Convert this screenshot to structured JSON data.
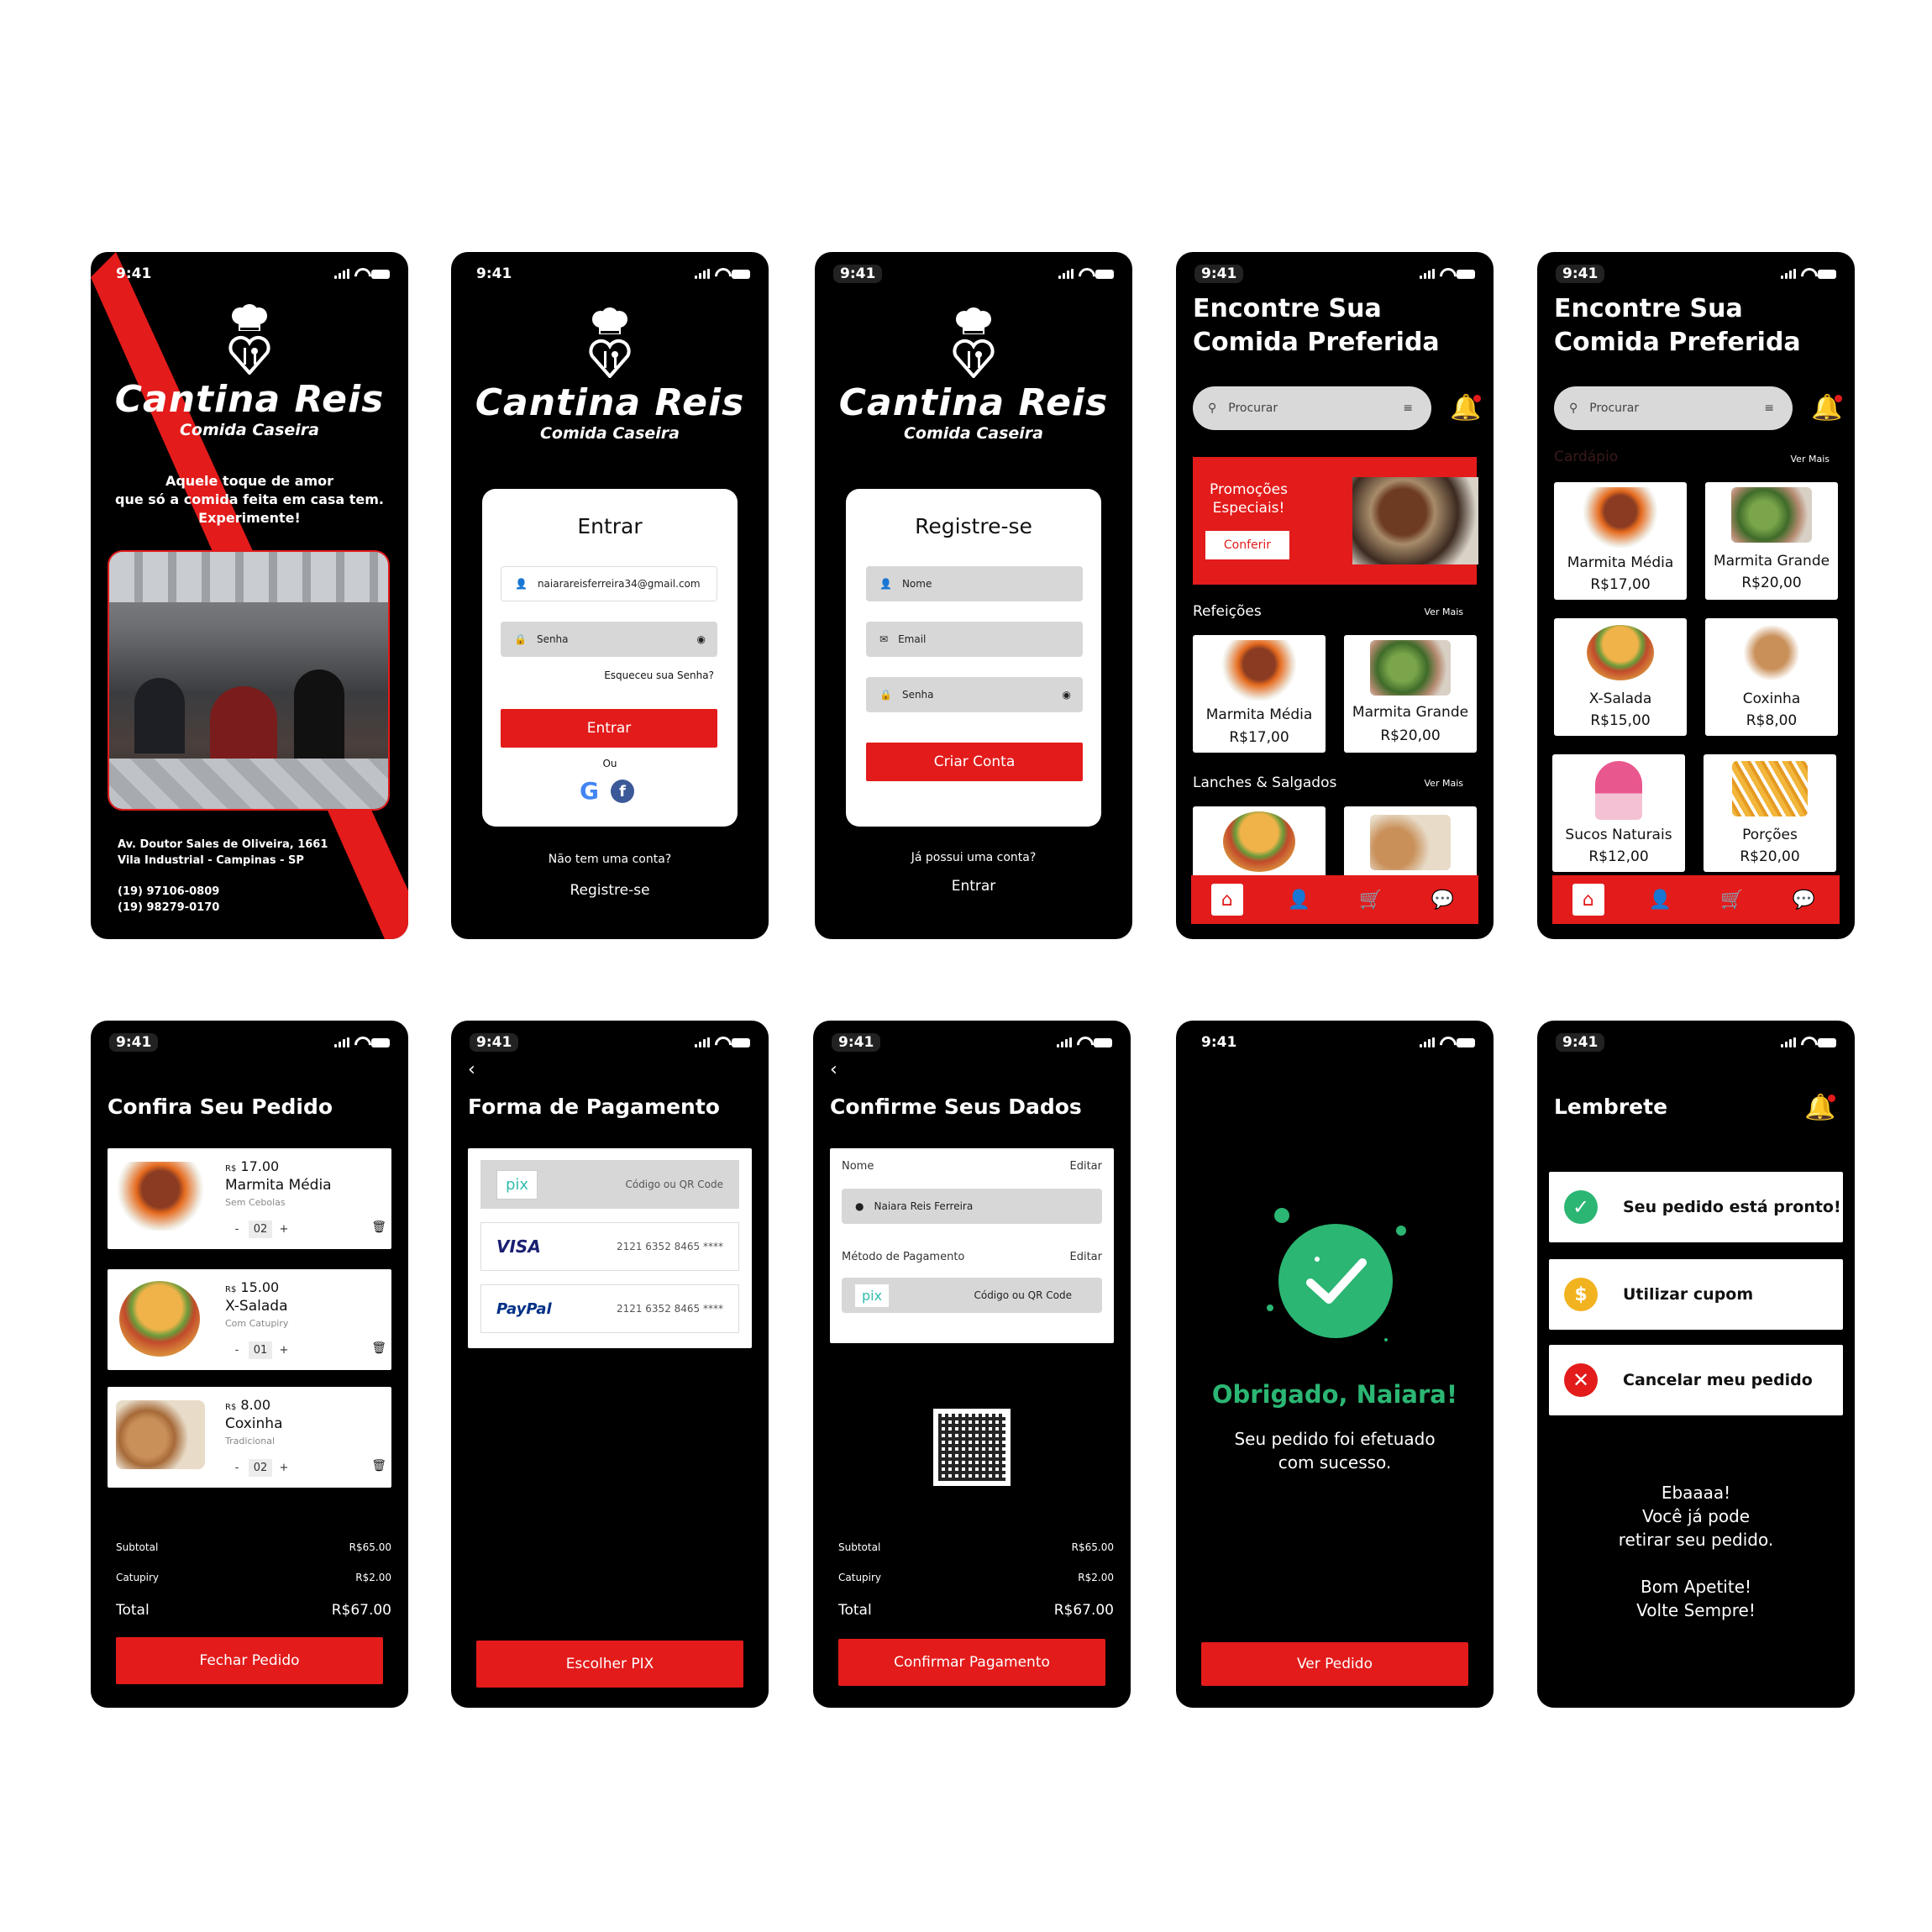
{
  "status": {
    "time": "9:41"
  },
  "brand": {
    "name": "Cantina Reis",
    "tagline": "Comida Caseira"
  },
  "welcome": {
    "slogan_1": "Aquele toque de amor",
    "slogan_2": "que só a comida feita em casa tem.",
    "slogan_3": "Experimente!",
    "address_1": "Av. Doutor Sales de Oliveira, 1661",
    "address_2": "Vila Industrial - Campinas - SP",
    "phone_1": "(19) 97106-0809",
    "phone_2": "(19) 98279-0170"
  },
  "login": {
    "title": "Entrar",
    "email_value": "naiarareisferreira34@gmail.com",
    "password_placeholder": "Senha",
    "forgot": "Esqueceu sua Senha?",
    "submit": "Entrar",
    "or": "Ou",
    "no_account": "Não tem uma conta?",
    "register_link": "Registre-se"
  },
  "register": {
    "title": "Registre-se",
    "name_placeholder": "Nome",
    "email_placeholder": "Email",
    "password_placeholder": "Senha",
    "submit": "Criar Conta",
    "have_account": "Já possui uma conta?",
    "login_link": "Entrar"
  },
  "home": {
    "title_1": "Encontre Sua",
    "title_2": "Comida Preferida",
    "search_placeholder": "Procurar",
    "promo_1": "Promoções",
    "promo_2": "Especiais!",
    "promo_button": "Conferir",
    "section_meals": "Refeições",
    "section_snacks": "Lanches & Salgados",
    "see_more": "Ver Mais",
    "section_cardapio": "Cardápio",
    "items": [
      {
        "name": "Marmita Média",
        "price": "R$17,00"
      },
      {
        "name": "Marmita Grande",
        "price": "R$20,00"
      },
      {
        "name": "X-Salada",
        "price": "R$15,00"
      },
      {
        "name": "Coxinha",
        "price": "R$8,00"
      },
      {
        "name": "Sucos Naturais",
        "price": "R$12,00"
      },
      {
        "name": "Porções",
        "price": "R$20,00"
      }
    ]
  },
  "order": {
    "title": "Confira Seu Pedido",
    "currency": "R$",
    "items": [
      {
        "price": "17.00",
        "name": "Marmita Média",
        "note": "Sem Cebolas",
        "qty": "02"
      },
      {
        "price": "15.00",
        "name": "X-Salada",
        "note": "Com Catupiry",
        "qty": "01"
      },
      {
        "price": "8.00",
        "name": "Coxinha",
        "note": "Tradicional",
        "qty": "02"
      }
    ],
    "subtotal_label": "Subtotal",
    "subtotal": "R$65.00",
    "extra_label": "Catupiry",
    "extra": "R$2.00",
    "total_label": "Total",
    "total": "R$67.00",
    "button": "Fechar Pedido",
    "minus": "-",
    "plus": "+"
  },
  "payment": {
    "title": "Forma de Pagamento",
    "pix_label": "pix",
    "pix_text": "Código ou QR Code",
    "visa": "VISA",
    "visa_number": "2121 6352 8465 ****",
    "paypal": "PayPal",
    "paypal_number": "2121 6352 8465 ****",
    "button": "Escolher PIX"
  },
  "confirm": {
    "title": "Confirme Seus Dados",
    "name_label": "Nome",
    "edit": "Editar",
    "name_value": "Naiara Reis Ferreira",
    "method_label": "Método de Pagamento",
    "pix_text": "Código ou QR Code",
    "subtotal": "R$65.00",
    "extra": "R$2.00",
    "total": "R$67.00",
    "button": "Confirmar Pagamento"
  },
  "success": {
    "thanks": "Obrigado, Naiara!",
    "msg_1": "Seu pedido foi efetuado",
    "msg_2": "com sucesso.",
    "button": "Ver Pedido"
  },
  "reminder": {
    "title": "Lembrete",
    "items": [
      "Seu pedido está pronto!",
      "Utilizar cupom",
      "Cancelar meu pedido"
    ],
    "msg_1": "Ebaaaa!",
    "msg_2": "Você já pode",
    "msg_3": "retirar seu pedido.",
    "msg_4": "Bom Apetite!",
    "msg_5": "Volte Sempre!"
  },
  "colors": {
    "accent": "#e31b1b",
    "success": "#2bb673",
    "background": "#000000"
  }
}
